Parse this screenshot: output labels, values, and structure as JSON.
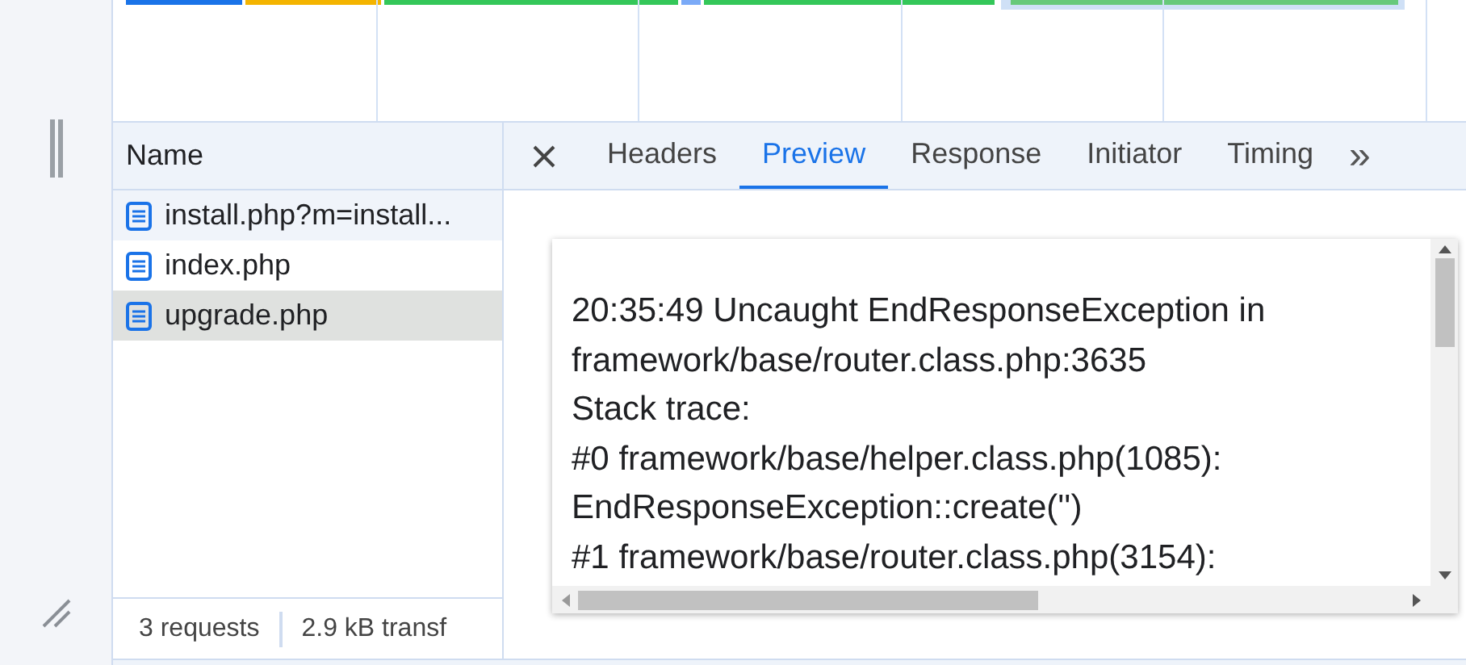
{
  "requests": {
    "column": "Name",
    "rows": [
      {
        "name": "install.php?m=install...",
        "selected": false
      },
      {
        "name": "index.php",
        "selected": false
      },
      {
        "name": "upgrade.php",
        "selected": true
      }
    ],
    "status": [
      "3 requests",
      "2.9 kB transf"
    ]
  },
  "tabs": [
    {
      "label": "Headers",
      "selected": false
    },
    {
      "label": "Preview",
      "selected": true
    },
    {
      "label": "Response",
      "selected": false
    },
    {
      "label": "Initiator",
      "selected": false
    },
    {
      "label": "Timing",
      "selected": false
    }
  ],
  "more": "»",
  "preview": [
    "20:35:49 Uncaught EndResponseException in",
    "framework/base/router.class.php:3635",
    "Stack trace:",
    "#0 framework/base/helper.class.php(1085):",
    "EndResponseException::create('')",
    "#1 framework/base/router.class.php(3154):"
  ]
}
